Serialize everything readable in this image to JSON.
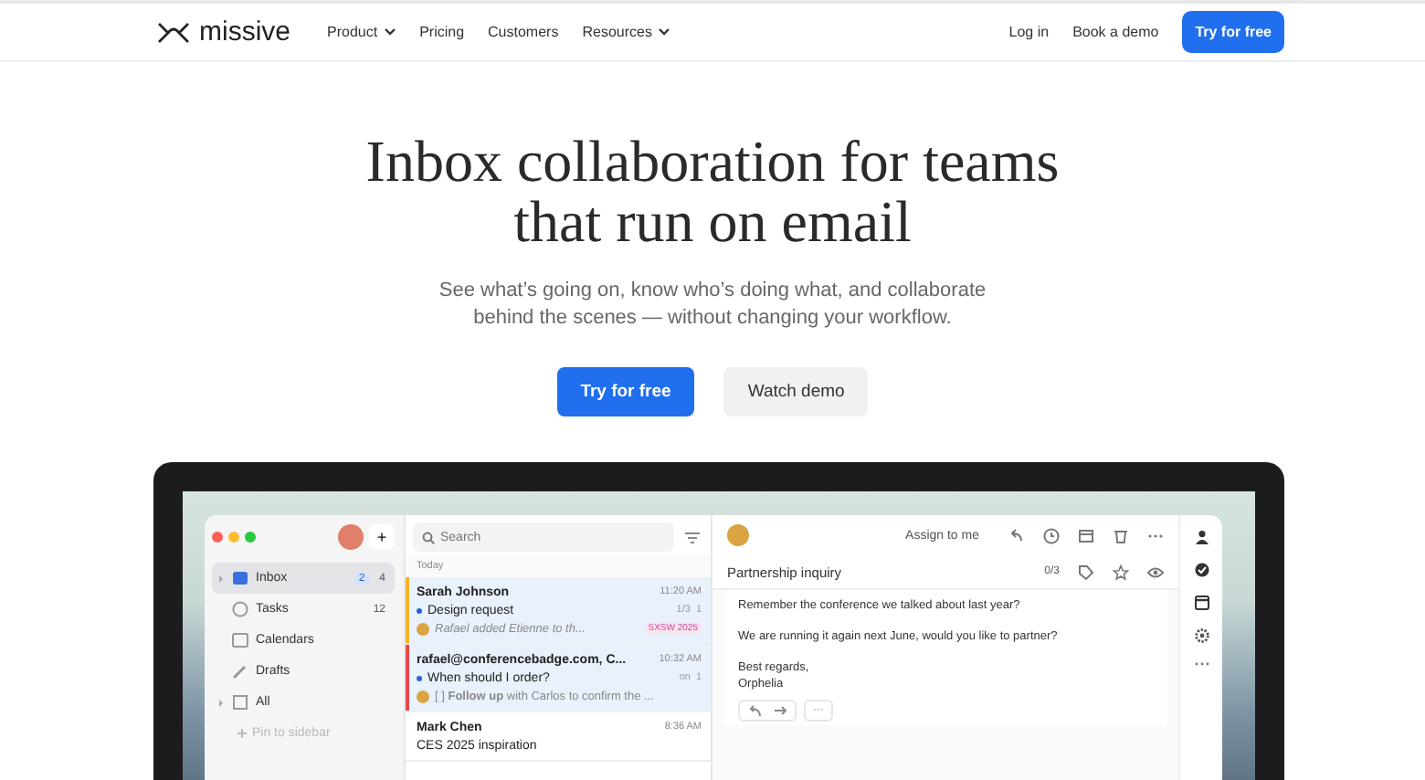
{
  "nav": {
    "logo": "missive",
    "links": [
      {
        "label": "Product",
        "dropdown": true
      },
      {
        "label": "Pricing",
        "dropdown": false
      },
      {
        "label": "Customers",
        "dropdown": false
      },
      {
        "label": "Resources",
        "dropdown": true
      }
    ],
    "login": "Log in",
    "demo": "Book a demo",
    "cta": "Try for free"
  },
  "hero": {
    "title_lines": [
      "Inbox collaboration for teams",
      "that run on email"
    ],
    "subtitle_lines": [
      "See what’s going on, know who’s doing what, and collaborate",
      "behind the scenes — without changing your workflow."
    ],
    "buttons": [
      {
        "label": "Try for free",
        "kind": "primary"
      },
      {
        "label": "Watch demo",
        "kind": "secondary"
      }
    ]
  },
  "app": {
    "sidebar": {
      "compose": "+",
      "items": [
        {
          "label": "Inbox",
          "selected": true,
          "expandable": true,
          "badges": [
            {
              "text": "2",
              "highlight": true
            },
            {
              "text": "4",
              "highlight": false
            }
          ]
        },
        {
          "label": "Tasks",
          "selected": false,
          "expandable": false,
          "badges": [
            {
              "text": "12",
              "highlight": false
            }
          ]
        },
        {
          "label": "Calendars",
          "selected": false,
          "expandable": false
        },
        {
          "label": "Drafts",
          "selected": false,
          "expandable": false
        },
        {
          "label": "All",
          "selected": false,
          "expandable": true
        }
      ],
      "pin": "Pin to sidebar"
    },
    "list": {
      "search": {
        "placeholder": "Search"
      },
      "section": "Today",
      "conversations": [
        {
          "sender": "Sarah Johnson",
          "time": "11:20 AM",
          "subject": "Design request",
          "unread": true,
          "selected": true,
          "color": "#f0b429",
          "meta": [
            "1/3",
            "1"
          ],
          "preview": "Rafael added Etienne to th...",
          "preview_italic": true,
          "tag": "SXSW 2025"
        },
        {
          "sender": "rafael@conferencebadge.com, C...",
          "time": "10:32 AM",
          "subject": "When should I order?",
          "unread": true,
          "selected": true,
          "color": "#e5484d",
          "meta": [
            "on",
            "1"
          ],
          "preview": "[ ] **Follow up** with Carlos to confirm the ...",
          "preview_italic": false
        },
        {
          "sender": "Mark Chen",
          "time": "8:36 AM",
          "subject": "CES 2025 inspiration",
          "unread": false,
          "selected": false
        }
      ]
    },
    "reader": {
      "assign": "Assign to me",
      "subject": "Partnership inquiry",
      "tasks": "0/3",
      "body": [
        "Remember the conference we talked about last year?",
        "We are running it again next June, would you like to partner?"
      ],
      "signoff": [
        "Best regards,",
        "Orphelia"
      ],
      "more": "···"
    }
  }
}
